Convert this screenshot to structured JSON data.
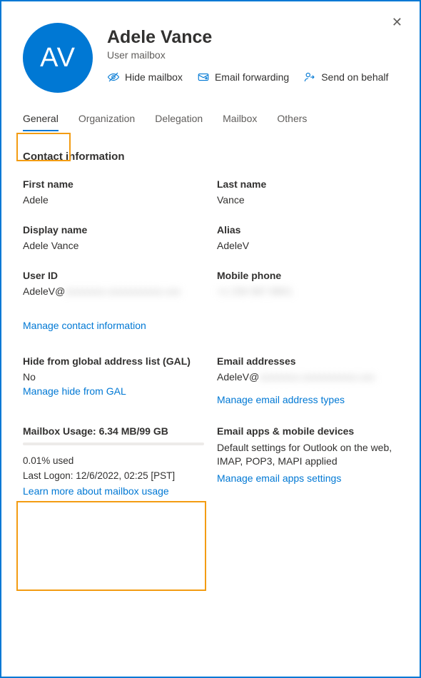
{
  "header": {
    "initials": "AV",
    "name": "Adele Vance",
    "subtitle": "User mailbox",
    "actions": {
      "hide": "Hide mailbox",
      "forward": "Email forwarding",
      "send_on_behalf": "Send on behalf"
    }
  },
  "tabs": {
    "general": "General",
    "organization": "Organization",
    "delegation": "Delegation",
    "mailbox": "Mailbox",
    "others": "Others"
  },
  "contact": {
    "title": "Contact information",
    "first_name_label": "First name",
    "first_name": "Adele",
    "last_name_label": "Last name",
    "last_name": "Vance",
    "display_name_label": "Display name",
    "display_name": "Adele Vance",
    "alias_label": "Alias",
    "alias": "AdeleV",
    "user_id_label": "User ID",
    "user_id_prefix": "AdeleV@",
    "user_id_hidden": "xxxxxxxx.xxxxxxxxxxx.xxx",
    "mobile_label": "Mobile phone",
    "mobile_hidden": "+1 234 567 8901",
    "manage_contact": "Manage contact information"
  },
  "gal": {
    "label": "Hide from global address list (GAL)",
    "value": "No",
    "manage": "Manage hide from GAL"
  },
  "emails": {
    "label": "Email addresses",
    "prefix": "AdeleV@",
    "hidden": "xxxxxxxx.xxxxxxxxxxx.xxx",
    "manage": "Manage email address types"
  },
  "usage": {
    "title": "Mailbox Usage: 6.34 MB/99 GB",
    "percent": "0.01% used",
    "last_logon": "Last Logon: 12/6/2022, 02:25 [PST]",
    "learn_more": "Learn more about mailbox usage"
  },
  "apps": {
    "label": "Email apps & mobile devices",
    "desc": "Default settings for Outlook on the web, IMAP, POP3, MAPI applied",
    "manage": "Manage email apps settings"
  }
}
